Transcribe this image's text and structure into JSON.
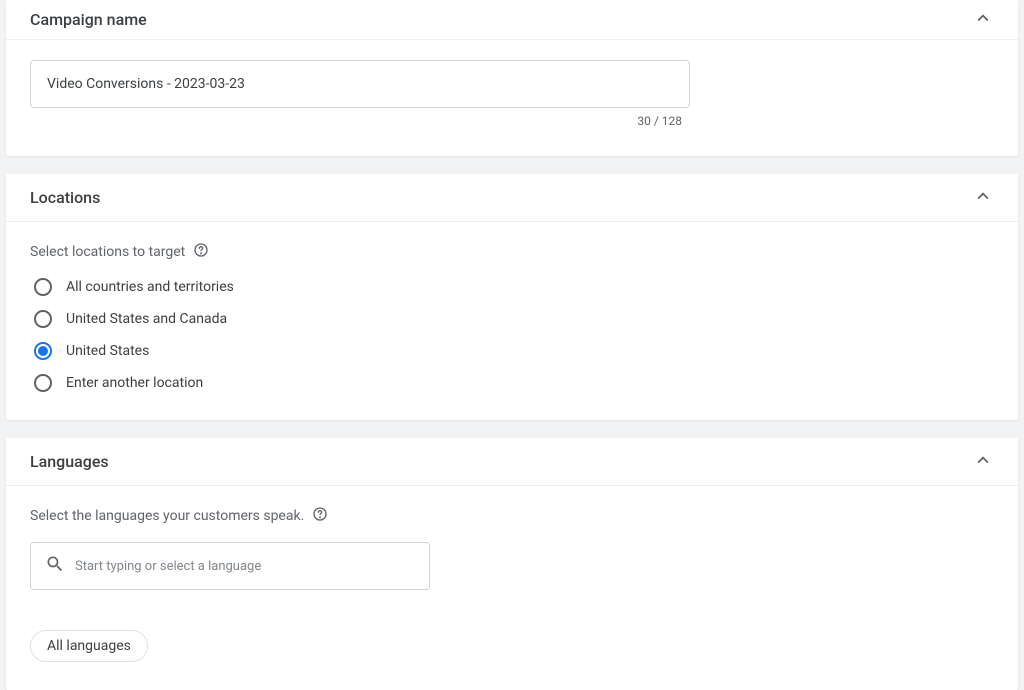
{
  "campaign_name": {
    "title": "Campaign name",
    "value": "Video Conversions - 2023-03-23",
    "char_count": "30 / 128"
  },
  "locations": {
    "title": "Locations",
    "helper": "Select locations to target",
    "options": [
      {
        "label": "All countries and territories"
      },
      {
        "label": "United States and Canada"
      },
      {
        "label": "United States"
      },
      {
        "label": "Enter another location"
      }
    ],
    "selected_index": 2
  },
  "languages": {
    "title": "Languages",
    "helper": "Select the languages your customers speak.",
    "search_placeholder": "Start typing or select a language",
    "chip": "All languages"
  }
}
